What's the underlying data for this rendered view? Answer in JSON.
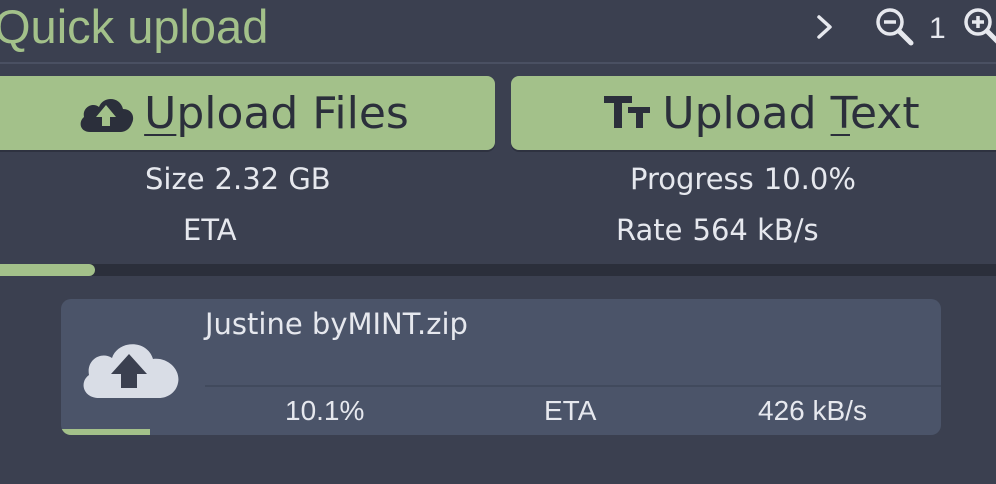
{
  "header": {
    "title": "Quick upload",
    "zoom_level": "1",
    "icons": [
      "chevron-right-icon",
      "zoom-out-icon",
      "zoom-in-icon"
    ]
  },
  "buttons": {
    "upload_files": {
      "underlined": "U",
      "rest": "pload Files",
      "icon": "cloud-upload-icon"
    },
    "upload_text": {
      "before": "Upload ",
      "underlined": "T",
      "after": "ext",
      "icon": "text-size-icon"
    }
  },
  "summary": {
    "size_label": "Size",
    "size_value": "2.32 GB",
    "progress_label": "Progress",
    "progress_value": "10.0%",
    "eta_label": "ETA",
    "eta_value": "",
    "rate_label": "Rate",
    "rate_value": "564 kB/s",
    "progress_fraction": 0.095
  },
  "file": {
    "name": "Justine byMINT.zip",
    "percent": "10.1%",
    "eta": "ETA",
    "rate": "426 kB/s",
    "progress_fraction": 0.101,
    "icon": "cloud-upload-icon"
  },
  "colors": {
    "background": "#3b4050",
    "accent": "#a3c18a",
    "card": "#4b5469",
    "track": "#2b2f3b",
    "text": "#e6e8ee"
  }
}
